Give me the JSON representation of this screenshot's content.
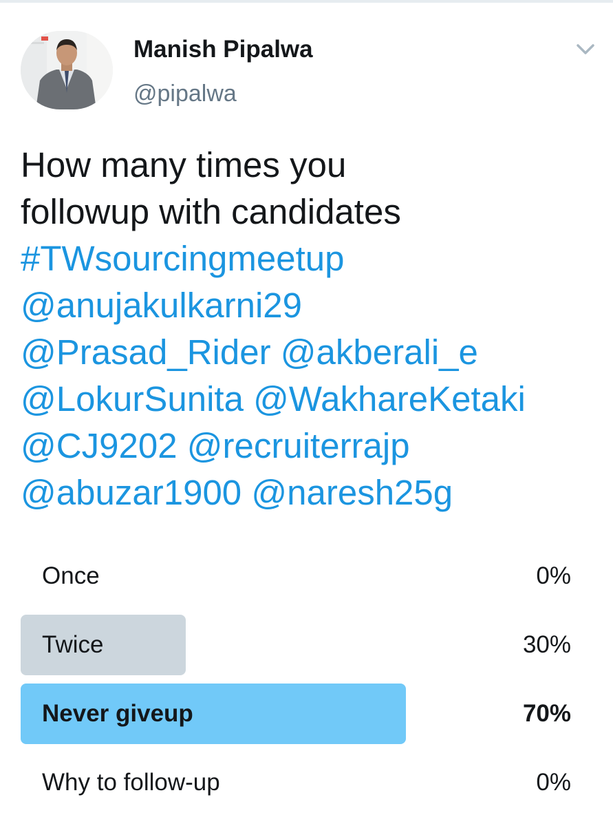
{
  "tweet": {
    "author": {
      "display_name": "Manish Pipalwa",
      "handle": "@pipalwa",
      "avatar_icon": "profile-photo"
    },
    "menu_icon": "chevron-down-icon",
    "text": {
      "plain_lines": [
        "How many times you",
        "followup with candidates"
      ],
      "hashtag": "#TWsourcingmeetup",
      "mention_lines": [
        [
          "@anujakulkarni29"
        ],
        [
          "@Prasad_Rider",
          "@akberali_e"
        ],
        [
          "@LokurSunita",
          "@WakhareKetaki"
        ],
        [
          "@CJ9202",
          "@recruiterrajp"
        ],
        [
          "@abuzar1900",
          "@naresh25g"
        ]
      ]
    },
    "poll": {
      "options": [
        {
          "label": "Once",
          "percent_text": "0%",
          "percent": 0,
          "winner": false
        },
        {
          "label": "Twice",
          "percent_text": "30%",
          "percent": 30,
          "winner": false
        },
        {
          "label": "Never giveup",
          "percent_text": "70%",
          "percent": 70,
          "winner": true
        },
        {
          "label": "Why to follow-up",
          "percent_text": "0%",
          "percent": 0,
          "winner": false
        }
      ]
    },
    "colors": {
      "link": "#1b95e0",
      "winner_bar": "#71c9f8",
      "loser_bar": "#ccd6dd",
      "text": "#14171a",
      "secondary_text": "#657786"
    }
  }
}
